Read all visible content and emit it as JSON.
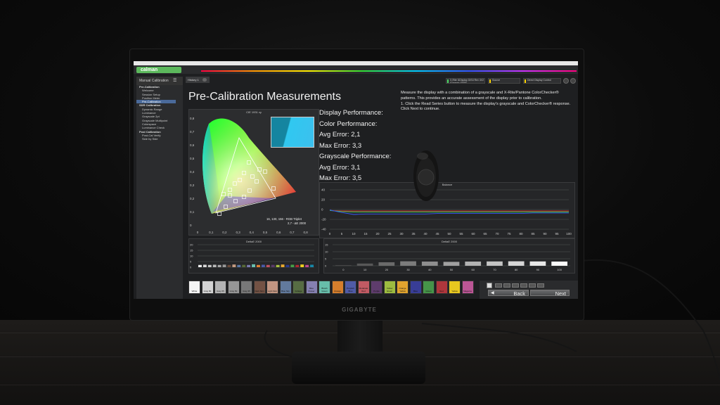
{
  "app": {
    "name": "calman",
    "tab": "History 1",
    "menu_title": "Manual Calibration",
    "brand": "GIGABYTE"
  },
  "sidebar": {
    "items": [
      {
        "label": "Pre-Calibration",
        "header": true
      },
      {
        "label": "Welcome"
      },
      {
        "label": "Session Setup"
      },
      {
        "label": "Position Meter"
      },
      {
        "label": "Pre-Calibration",
        "active": true
      },
      {
        "label": "SDR Calibration",
        "header": true
      },
      {
        "label": "Dynamic Range"
      },
      {
        "label": "Luminance"
      },
      {
        "label": "Grayscale 2pt"
      },
      {
        "label": "Grayscale Multipoint"
      },
      {
        "label": "Colorspace"
      },
      {
        "label": "Luminance Check"
      },
      {
        "label": "Post Calibration",
        "header": true
      },
      {
        "label": "Post-Cal Verify"
      },
      {
        "label": "Side by Side"
      }
    ]
  },
  "devices": {
    "meter": "X-Rite i1Display DIS4\nRev 4V2 (Generic (SMF)",
    "source": "Source",
    "display": "Direct Display Control"
  },
  "page": {
    "title": "Pre-Calibration Measurements",
    "instructions": "Measure the display with a combination of a grayscale and X-Rite/Pantone ColorChecker® patterns. This provides an accurate assessment of the display prior to calibration.\n1. Click the Read Series button to measure the display's grayscale and ColorChecker® response.\nClick Next to continue."
  },
  "metrics": {
    "display_perf": "Display Performance:",
    "color_perf": "Color Performance:",
    "color_avg": "Avg Error: 2,1",
    "color_max": "Max Error: 3,3",
    "gray_perf": "Grayscale Performance:",
    "gray_avg": "Avg Error: 3,1",
    "gray_max": "Max Error: 3,5"
  },
  "cie": {
    "title": "CIE 1931 xy",
    "rgb_triplet": "16, 130, 156 - RGB Triplet",
    "delta": "2,7 - ΔE 2000",
    "x_ticks": [
      "0",
      "0,1",
      "0,2",
      "0,3",
      "0,4",
      "0,5",
      "0,6",
      "0,7",
      "0,8"
    ],
    "y_ticks": [
      "0,8",
      "0,7",
      "0,6",
      "0,5",
      "0,4",
      "0,3",
      "0,2",
      "0,1",
      "0"
    ],
    "swatch_color": "#10829c"
  },
  "balance": {
    "title": "Balance",
    "y_ticks": [
      "40",
      "20",
      "0",
      "-20",
      "-40"
    ],
    "x_ticks": [
      "0",
      "5",
      "10",
      "15",
      "20",
      "25",
      "30",
      "35",
      "40",
      "45",
      "50",
      "55",
      "60",
      "65",
      "70",
      "75",
      "80",
      "85",
      "90",
      "95",
      "100"
    ],
    "series": [
      {
        "color": "#ff3b30",
        "values": [
          -2,
          -3,
          -3,
          -3,
          -3,
          -3,
          -3,
          -3,
          -3,
          -3,
          -3,
          -3,
          -3,
          -3,
          -3,
          -3,
          -3,
          -3,
          -3,
          -3,
          -3
        ]
      },
      {
        "color": "#34c759",
        "values": [
          -2,
          -4,
          -5,
          -5,
          -5,
          -5,
          -5,
          -5,
          -5,
          -5,
          -5,
          -5,
          -5,
          -5,
          -5,
          -5,
          -5,
          -5,
          -5,
          -5,
          -5
        ]
      },
      {
        "color": "#3a5bff",
        "values": [
          -1,
          -6,
          -10,
          -9,
          -9,
          -9,
          -9,
          -9,
          -9,
          -8,
          -8,
          -8,
          -8,
          -8,
          -8,
          -8,
          -8,
          -7,
          -7,
          -7,
          -7
        ]
      }
    ]
  },
  "deltae_left": {
    "title": "DeltaE 2000",
    "y_ticks": [
      "20",
      "15",
      "10",
      "5",
      "0"
    ],
    "bars": [
      {
        "color": "#f0f0f0",
        "value": 2
      },
      {
        "color": "#d8d8d8",
        "value": 2.2
      },
      {
        "color": "#c8c8c8",
        "value": 2
      },
      {
        "color": "#b8b8b8",
        "value": 2.2
      },
      {
        "color": "#a8a8a8",
        "value": 2
      },
      {
        "color": "#989898",
        "value": 2.3
      },
      {
        "color": "#6a4a3a",
        "value": 2
      },
      {
        "color": "#c49a80",
        "value": 2.4
      },
      {
        "color": "#5a78a8",
        "value": 2
      },
      {
        "color": "#586a38",
        "value": 2.1
      },
      {
        "color": "#7a7ab0",
        "value": 2
      },
      {
        "color": "#68c0b0",
        "value": 2.6
      },
      {
        "color": "#e08030",
        "value": 2
      },
      {
        "color": "#4a5aa8",
        "value": 2.2
      },
      {
        "color": "#c05060",
        "value": 2
      },
      {
        "color": "#5a3a6a",
        "value": 2.1
      },
      {
        "color": "#a8c040",
        "value": 2
      },
      {
        "color": "#e8a830",
        "value": 2.4
      },
      {
        "color": "#283890",
        "value": 2
      },
      {
        "color": "#48a048",
        "value": 2.2
      },
      {
        "color": "#b02830",
        "value": 2
      },
      {
        "color": "#f0d020",
        "value": 2.4
      },
      {
        "color": "#c04890",
        "value": 2
      },
      {
        "color": "#1888a8",
        "value": 2.2
      }
    ]
  },
  "deltae_right": {
    "title": "DeltaE 2000",
    "y_ticks": [
      "15",
      "10",
      "5",
      "0"
    ],
    "x_ticks": [
      "0",
      "10",
      "20",
      "30",
      "40",
      "50",
      "60",
      "70",
      "80",
      "90",
      "100"
    ],
    "values": [
      0.5,
      1.6,
      2.5,
      3.2,
      3.0,
      2.8,
      3.0,
      3.1,
      3.2,
      3.1,
      3.0
    ]
  },
  "swatches": [
    {
      "label": "White",
      "color": "#f4f4f4"
    },
    {
      "label": "Gray 80",
      "color": "#d4d4d4"
    },
    {
      "label": "Gray 65",
      "color": "#b4b4b4"
    },
    {
      "label": "Gray 50",
      "color": "#969696"
    },
    {
      "label": "Gray 35",
      "color": "#787878"
    },
    {
      "label": "Dark Skin",
      "color": "#735244"
    },
    {
      "label": "Light Skin",
      "color": "#c29682"
    },
    {
      "label": "Blue Sky",
      "color": "#627a9d"
    },
    {
      "label": "Foliage",
      "color": "#576c43"
    },
    {
      "label": "Blue Flower",
      "color": "#8580b1"
    },
    {
      "label": "Bluish Green",
      "color": "#67bdaa"
    },
    {
      "label": "Orange",
      "color": "#d67e2c"
    },
    {
      "label": "Purplish Blue",
      "color": "#505ba6"
    },
    {
      "label": "Moderate Red",
      "color": "#c15a63"
    },
    {
      "label": "Purple",
      "color": "#5e3c6c"
    },
    {
      "label": "Yellow Green",
      "color": "#9dbc40"
    },
    {
      "label": "Orange Yellow",
      "color": "#e0a32e"
    },
    {
      "label": "Blue",
      "color": "#383d96"
    },
    {
      "label": "Green",
      "color": "#469449"
    },
    {
      "label": "Red",
      "color": "#af363c"
    },
    {
      "label": "Yellow",
      "color": "#e7c71f"
    },
    {
      "label": "Magenta",
      "color": "#bb5695"
    }
  ],
  "nav": {
    "back": "Back",
    "next": "Next"
  }
}
